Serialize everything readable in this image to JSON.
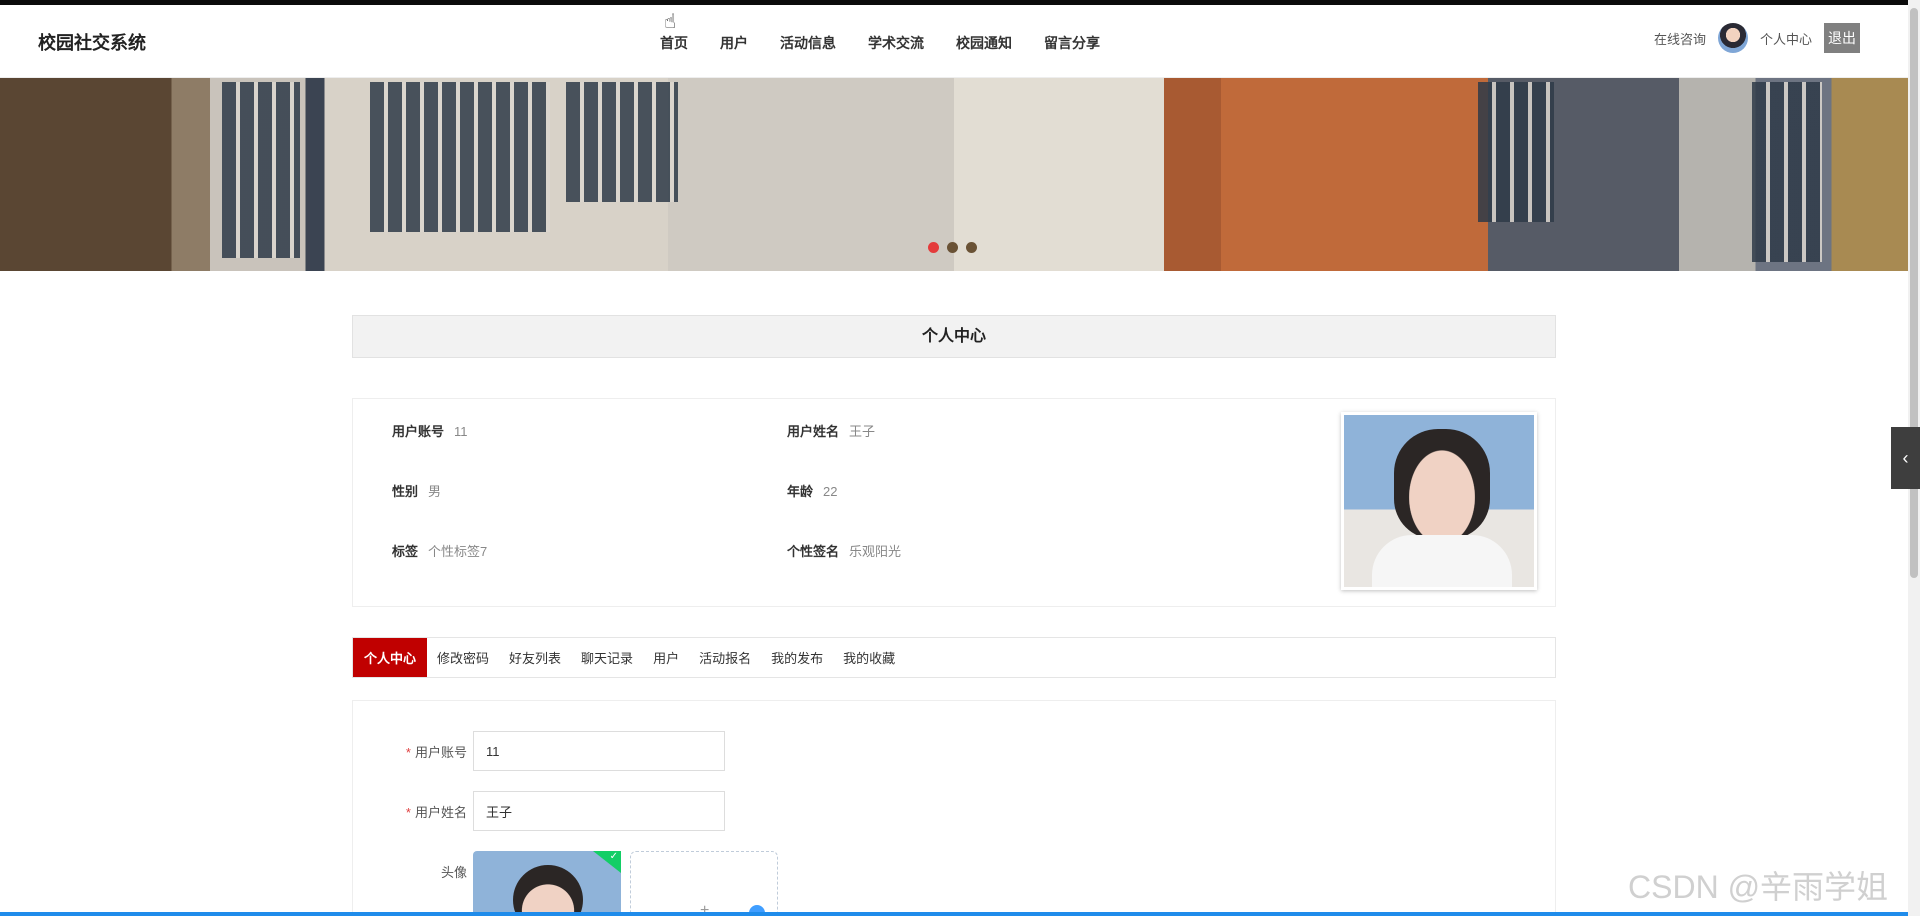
{
  "header": {
    "brand": "校园社交系统",
    "nav": [
      "首页",
      "用户",
      "活动信息",
      "学术交流",
      "校园通知",
      "留言分享"
    ],
    "online_consult": "在线咨询",
    "user_center": "个人中心",
    "logout": "退出"
  },
  "banner": {
    "slides": 3,
    "active_slide": 1
  },
  "page_title": "个人中心",
  "info": {
    "account_label": "用户账号",
    "account_value": "11",
    "name_label": "用户姓名",
    "name_value": "王子",
    "gender_label": "性别",
    "gender_value": "男",
    "age_label": "年龄",
    "age_value": "22",
    "tag_label": "标签",
    "tag_value": "个性标签7",
    "signature_label": "个性签名",
    "signature_value": "乐观阳光"
  },
  "tabs": [
    "个人中心",
    "修改密码",
    "好友列表",
    "聊天记录",
    "用户",
    "活动报名",
    "我的发布",
    "我的收藏"
  ],
  "active_tab": "个人中心",
  "form": {
    "account_label": "用户账号",
    "account_value": "11",
    "name_label": "用户姓名",
    "name_value": "王子",
    "avatar_label": "头像",
    "upload_plus": "+"
  },
  "watermark": "CSDN @辛雨学姐",
  "colors": {
    "accent": "#c00000",
    "active_dot": "#e43b3b",
    "upload_ok": "#13ce66",
    "link_blue": "#409eff"
  }
}
